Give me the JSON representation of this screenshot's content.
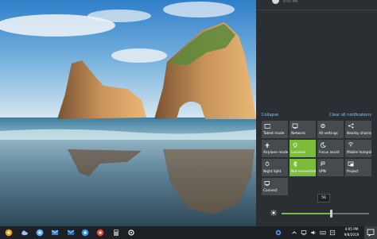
{
  "notification": {
    "time": "4:05 PM"
  },
  "action_center": {
    "collapse_label": "Collapse",
    "clear_label": "Clear all notifications",
    "accent_color": "#7dbb3a",
    "tiles": [
      {
        "label": "Tablet mode",
        "icon": "tablet-mode-icon",
        "on": false
      },
      {
        "label": "Network",
        "icon": "network-icon",
        "on": false
      },
      {
        "label": "All settings",
        "icon": "gear-icon",
        "on": false
      },
      {
        "label": "Nearby sharing",
        "icon": "share-icon",
        "on": false
      },
      {
        "label": "Airplane mode",
        "icon": "airplane-icon",
        "on": false
      },
      {
        "label": "Location",
        "icon": "location-icon",
        "on": true
      },
      {
        "label": "Focus assist",
        "icon": "moon-icon",
        "on": false
      },
      {
        "label": "Mobile hotspot",
        "icon": "hotspot-icon",
        "on": false
      },
      {
        "label": "Night light",
        "icon": "night-light-icon",
        "on": false
      },
      {
        "label": "Not connected",
        "icon": "bluetooth-icon",
        "on": true
      },
      {
        "label": "VPN",
        "icon": "vpn-icon",
        "on": false
      },
      {
        "label": "Project",
        "icon": "project-icon",
        "on": false
      },
      {
        "label": "Connect",
        "icon": "connect-icon",
        "on": false
      }
    ],
    "brightness": {
      "value": "56",
      "level": 0.56
    }
  },
  "taskbar": {
    "pinned_apps": [
      {
        "name": "chrome-canary-icon",
        "color": "#e8a317"
      },
      {
        "name": "cloud-app-icon",
        "color": "#8fc7ff"
      },
      {
        "name": "edge-icon",
        "color": "#5fb3ff"
      },
      {
        "name": "mail-icon",
        "color": "#2f86d8"
      },
      {
        "name": "outlook-icon",
        "color": "#1f6fc5"
      },
      {
        "name": "photos-icon",
        "color": "#2f9bf0"
      },
      {
        "name": "chrome-icon",
        "color": "#e24b3b"
      },
      {
        "name": "calculator-icon",
        "color": "#9aa0a6"
      },
      {
        "name": "settings-icon",
        "color": "#ffffff"
      }
    ],
    "clock_time": "4:05 PM",
    "clock_date": "9/8/2019"
  }
}
